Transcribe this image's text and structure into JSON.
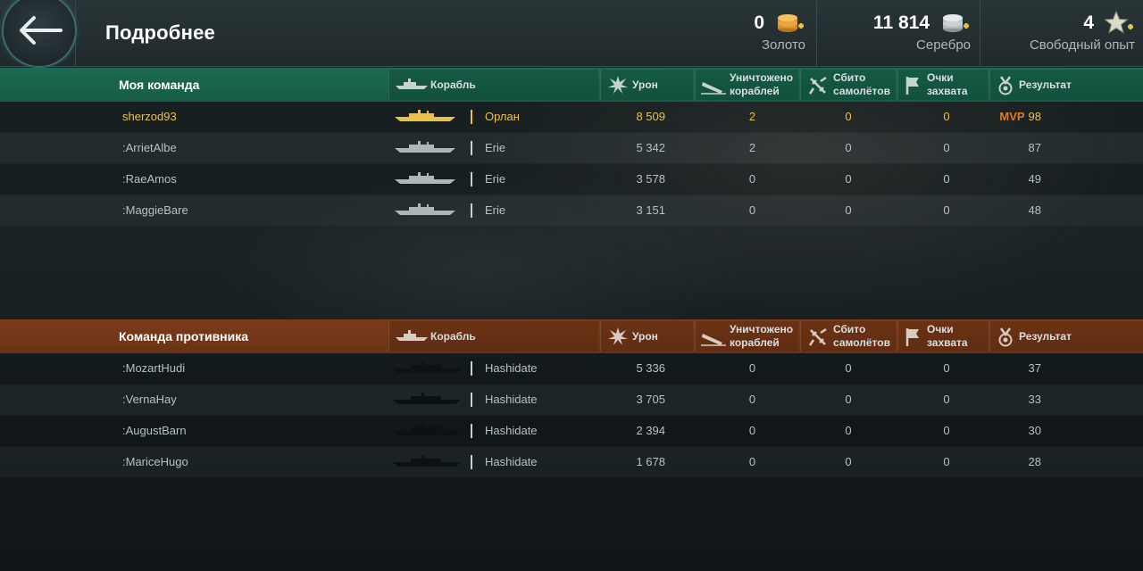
{
  "header": {
    "title": "Подробнее",
    "gold": {
      "value": "0",
      "label": "Золото"
    },
    "silver": {
      "value": "11 814",
      "label": "Серебро"
    },
    "free_xp": {
      "value": "4",
      "label": "Свободный опыт"
    }
  },
  "columns": {
    "ship": "Корабль",
    "damage": "Урон",
    "kills_l1": "Уничтожено",
    "kills_l2": "кораблей",
    "planes_l1": "Сбито",
    "planes_l2": "самолётов",
    "capture_l1": "Очки",
    "capture_l2": "захвата",
    "result": "Результат"
  },
  "my_team": {
    "name": "Моя команда",
    "rows": [
      {
        "player": "sherzod93",
        "ship": "Орлан",
        "damage": "8 509",
        "kills": "2",
        "planes": "0",
        "capture": "0",
        "mvp": "MVP",
        "result": "98"
      },
      {
        "player": ":ArrietAlbe",
        "ship": "Erie",
        "damage": "5 342",
        "kills": "2",
        "planes": "0",
        "capture": "0",
        "result": "87"
      },
      {
        "player": ":RaeAmos",
        "ship": "Erie",
        "damage": "3 578",
        "kills": "0",
        "planes": "0",
        "capture": "0",
        "result": "49"
      },
      {
        "player": ":MaggieBare",
        "ship": "Erie",
        "damage": "3 151",
        "kills": "0",
        "planes": "0",
        "capture": "0",
        "result": "48"
      }
    ]
  },
  "enemy_team": {
    "name": "Команда противника",
    "rows": [
      {
        "player": ":MozartHudi",
        "ship": "Hashidate",
        "damage": "5 336",
        "kills": "0",
        "planes": "0",
        "capture": "0",
        "result": "37"
      },
      {
        "player": ":VernaHay",
        "ship": "Hashidate",
        "damage": "3 705",
        "kills": "0",
        "planes": "0",
        "capture": "0",
        "result": "33"
      },
      {
        "player": ":AugustBarn",
        "ship": "Hashidate",
        "damage": "2 394",
        "kills": "0",
        "planes": "0",
        "capture": "0",
        "result": "30"
      },
      {
        "player": ":MariceHugo",
        "ship": "Hashidate",
        "damage": "1 678",
        "kills": "0",
        "planes": "0",
        "capture": "0",
        "result": "28"
      }
    ]
  },
  "colors": {
    "my_team_header": "#1d6a52",
    "enemy_team_header": "#7a3c1b",
    "self_highlight": "#e8c24a",
    "mvp": "#e07a2a"
  },
  "icons": {
    "back": "arrow-left-icon",
    "gold": "gold-coins-plus-icon",
    "silver": "silver-coins-plus-icon",
    "free_xp": "star-plus-icon",
    "ship": "ship-icon",
    "damage": "explosion-icon",
    "kills": "sinking-ship-icon",
    "planes": "plane-shot-down-icon",
    "capture": "capture-flag-icon",
    "result": "medal-icon"
  }
}
